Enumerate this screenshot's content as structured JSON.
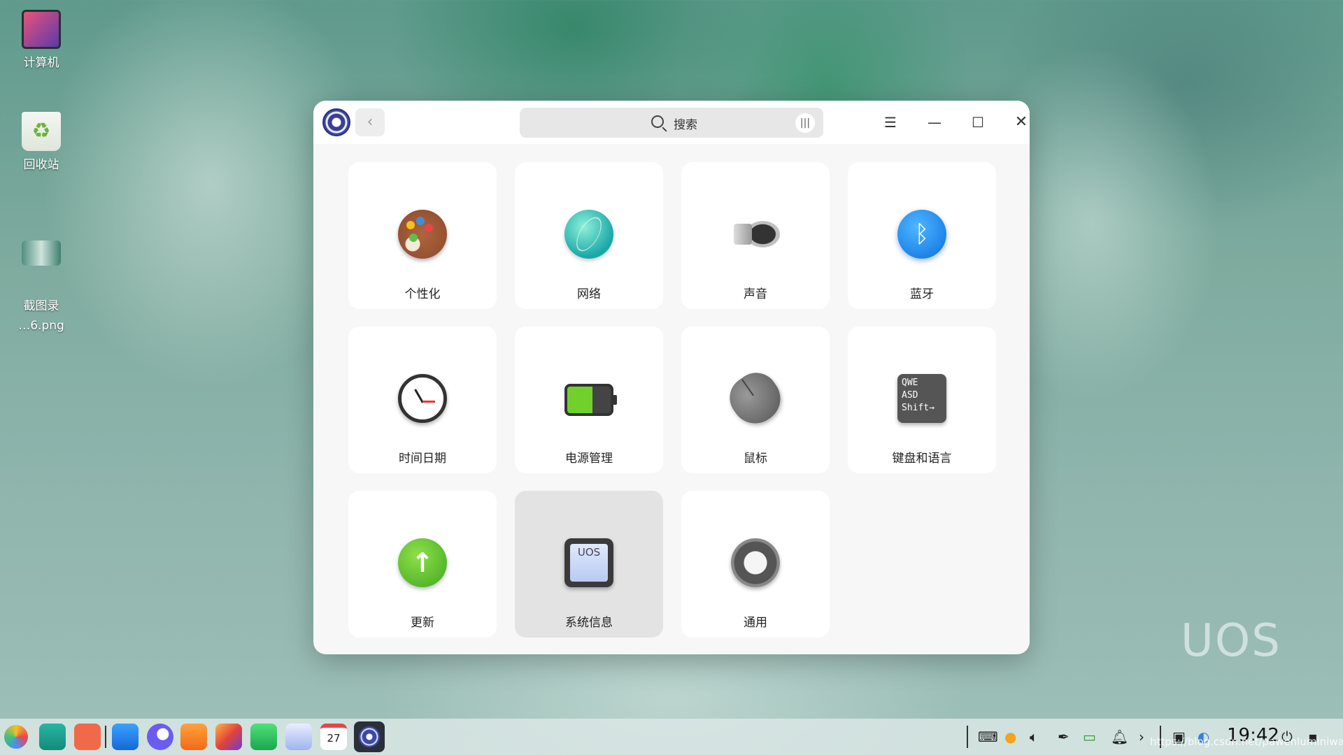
{
  "desktop": {
    "icons": [
      {
        "label": "计算机"
      },
      {
        "label": "回收站"
      },
      {
        "label": "截图录\n…6.png"
      }
    ],
    "watermark": "UOS"
  },
  "window": {
    "search": {
      "placeholder": "搜索"
    },
    "controls": {
      "back": "‹",
      "menu": "☰",
      "minimize": "—",
      "maximize": "☐",
      "close": "✕"
    },
    "modules": [
      {
        "label": "个性化",
        "icon": "palette-icon"
      },
      {
        "label": "网络",
        "icon": "network-icon"
      },
      {
        "label": "声音",
        "icon": "speaker-icon"
      },
      {
        "label": "蓝牙",
        "icon": "bluetooth-icon",
        "glyph": "ᛒ"
      },
      {
        "label": "时间日期",
        "icon": "clock-icon"
      },
      {
        "label": "电源管理",
        "icon": "battery-icon"
      },
      {
        "label": "鼠标",
        "icon": "mouse-icon"
      },
      {
        "label": "键盘和语言",
        "icon": "keyboard-icon",
        "glyph": "QWE\nASD\nShift→"
      },
      {
        "label": "更新",
        "icon": "update-icon",
        "glyph": "↑"
      },
      {
        "label": "系统信息",
        "icon": "system-info-icon",
        "selected": true
      },
      {
        "label": "通用",
        "icon": "gear-icon"
      }
    ]
  },
  "taskbar": {
    "clock": "19:42",
    "url_watermark": "https://blog.csdn.net/pawenluminiwan",
    "apps": [
      "launcher-icon",
      "multitask-icon",
      "app-grid-icon",
      "file-manager-icon",
      "browser-icon",
      "app-store-icon",
      "image-viewer-icon",
      "music-icon",
      "document-icon",
      "calendar-icon",
      "control-center-icon"
    ],
    "calendar_day": "27"
  }
}
